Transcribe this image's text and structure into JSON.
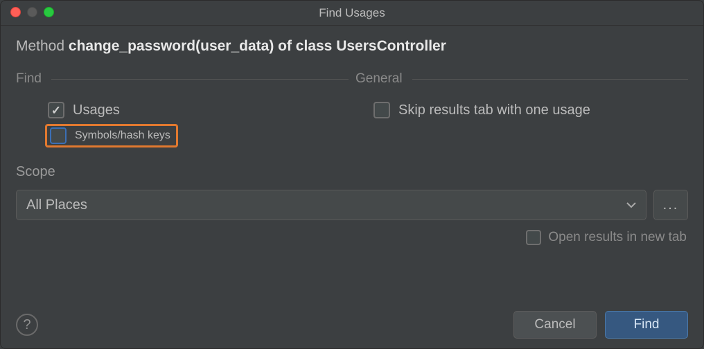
{
  "window": {
    "title": "Find Usages"
  },
  "subject": {
    "prefix": "Method ",
    "bold": "change_password(user_data) of class UsersController"
  },
  "sections": {
    "find": {
      "title": "Find",
      "usages": {
        "label": "Usages",
        "checked": true
      },
      "symbols": {
        "label": "Symbols/hash keys",
        "checked": false
      }
    },
    "general": {
      "title": "General",
      "skip": {
        "label": "Skip results tab with one usage",
        "checked": false
      }
    }
  },
  "scope": {
    "title": "Scope",
    "selected": "All Places",
    "dots": "..."
  },
  "open_in_new_tab": {
    "label": "Open results in new tab",
    "checked": false
  },
  "buttons": {
    "help": "?",
    "cancel": "Cancel",
    "find": "Find"
  }
}
